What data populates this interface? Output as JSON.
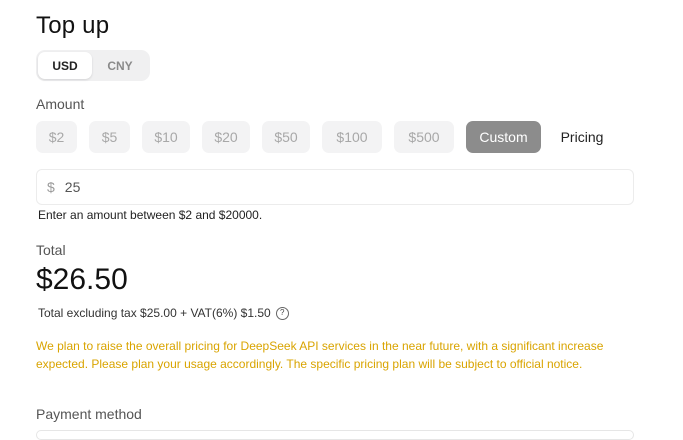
{
  "title": "Top up",
  "currency": {
    "options": [
      "USD",
      "CNY"
    ],
    "selected": "USD"
  },
  "amount": {
    "label": "Amount",
    "presets": [
      "$2",
      "$5",
      "$10",
      "$20",
      "$50",
      "$100",
      "$500"
    ],
    "custom_label": "Custom",
    "pricing_label": "Pricing",
    "selected": "Custom",
    "input_prefix": "$",
    "input_value": "25",
    "hint": "Enter an amount between $2 and $20000."
  },
  "total": {
    "label": "Total",
    "value": "$26.50",
    "breakdown": "Total excluding tax $25.00 + VAT(6%) $1.50"
  },
  "notice": "We plan to raise the overall pricing for DeepSeek API services in the near future, with a significant increase expected. Please plan your usage accordingly. The specific pricing plan will be subject to official notice.",
  "payment": {
    "label": "Payment method"
  },
  "colors": {
    "notice": "#d9a400",
    "selected_chip": "#8c8c8c",
    "chip_bg": "#f3f3f4"
  }
}
